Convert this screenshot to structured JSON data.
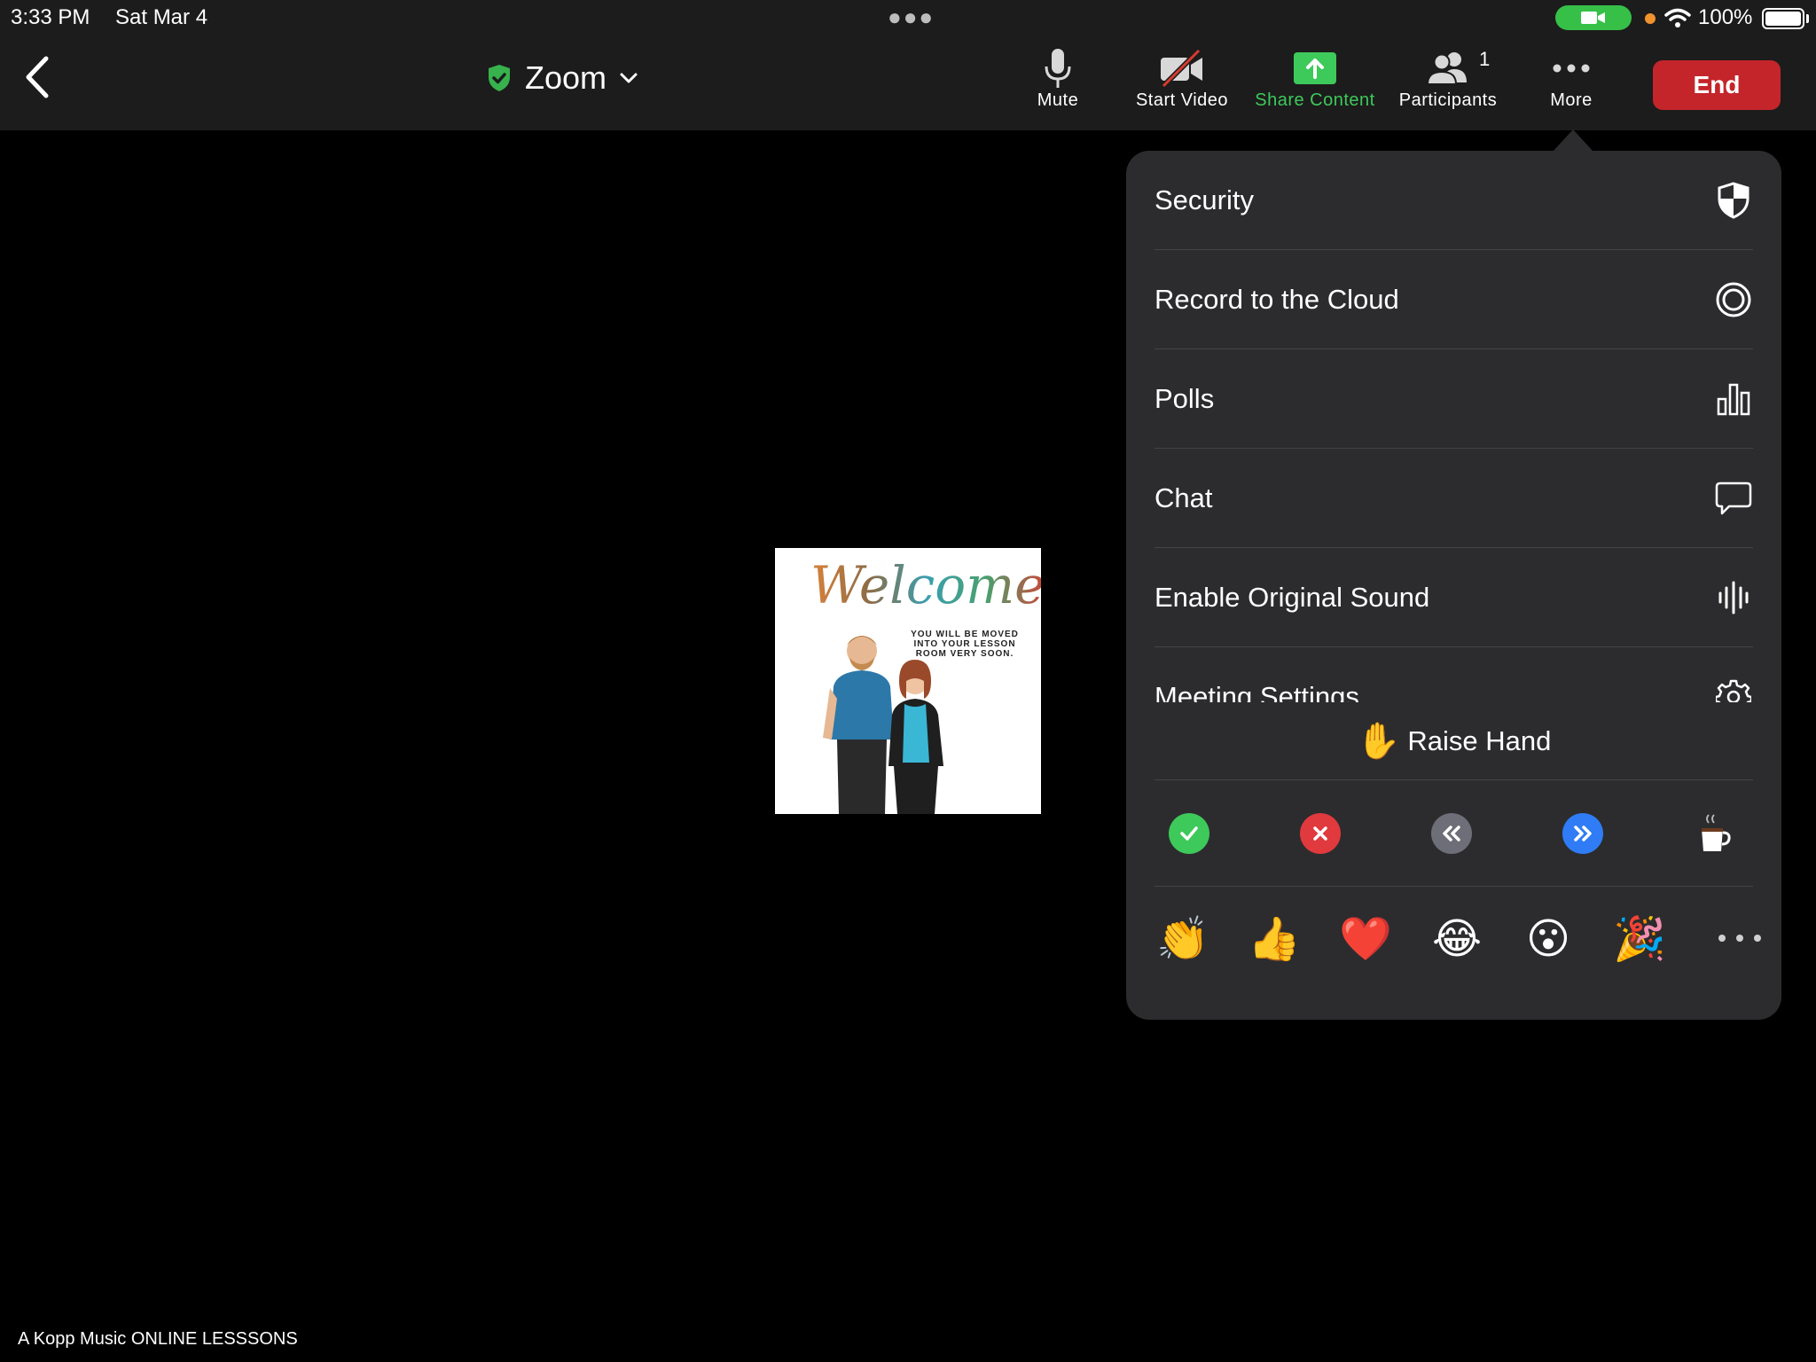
{
  "status_bar": {
    "time": "3:33 PM",
    "date": "Sat Mar 4",
    "battery": "100%"
  },
  "toolbar": {
    "title": "Zoom",
    "buttons": [
      {
        "label": "Mute",
        "icon": "microphone-icon"
      },
      {
        "label": "Start Video",
        "icon": "video-off-icon"
      },
      {
        "label": "Share Content",
        "icon": "share-screen-icon"
      },
      {
        "label": "Participants",
        "icon": "participants-icon"
      },
      {
        "label": "More",
        "icon": "more-dots-icon"
      }
    ],
    "participants_count": "1",
    "end_label": "End"
  },
  "colors": {
    "share_green": "#3ec95b",
    "end_red": "#c4252a",
    "menu_bg": "#2c2c2e",
    "shield_green": "#37b24d"
  },
  "video": {
    "welcome_word": "Welcome",
    "welcome_message": "YOU WILL BE MOVED INTO YOUR LESSON ROOM VERY SOON."
  },
  "meeting_name": "A Kopp Music ONLINE LESSSONS",
  "more_menu": {
    "items": [
      {
        "label": "Security",
        "icon": "shield-icon"
      },
      {
        "label": "Record to the Cloud",
        "icon": "record-icon"
      },
      {
        "label": "Polls",
        "icon": "bar-chart-icon"
      },
      {
        "label": "Chat",
        "icon": "chat-bubble-icon"
      },
      {
        "label": "Enable Original Sound",
        "icon": "audio-wave-icon"
      },
      {
        "label": "Meeting Settings",
        "icon": "gear-icon"
      }
    ],
    "raise_hand": {
      "emoji": "✋",
      "label": "Raise Hand"
    },
    "feedback": [
      "yes",
      "no",
      "go slower",
      "go faster",
      "coffee"
    ],
    "reactions": [
      "👏",
      "👍",
      "❤️",
      "😂",
      "😮",
      "🎉"
    ]
  }
}
